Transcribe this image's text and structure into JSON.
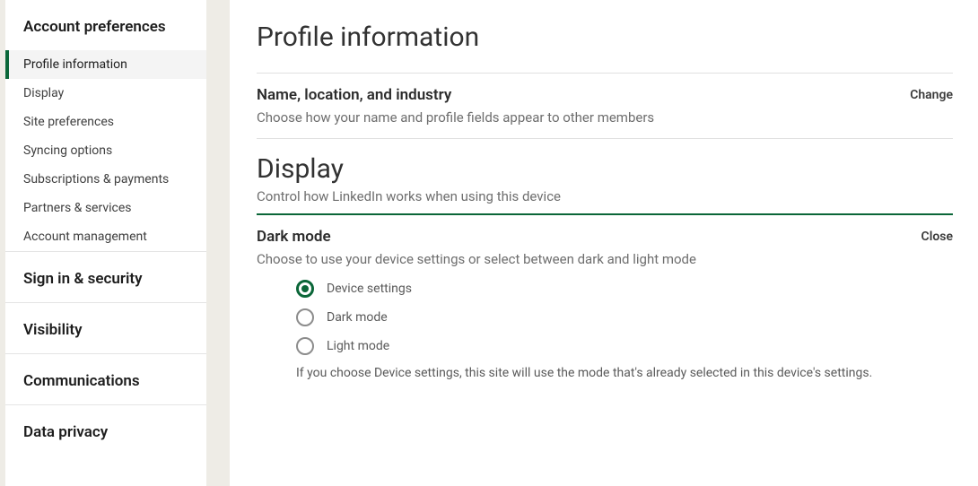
{
  "sidebar": {
    "groups": [
      {
        "header": "Account preferences",
        "items": [
          {
            "label": "Profile information",
            "active": true
          },
          {
            "label": "Display"
          },
          {
            "label": "Site preferences"
          },
          {
            "label": "Syncing options"
          },
          {
            "label": "Subscriptions & payments"
          },
          {
            "label": "Partners & services"
          },
          {
            "label": "Account management"
          }
        ]
      },
      {
        "header": "Sign in & security",
        "items": []
      },
      {
        "header": "Visibility",
        "items": []
      },
      {
        "header": "Communications",
        "items": []
      },
      {
        "header": "Data privacy",
        "items": []
      }
    ]
  },
  "main": {
    "profile_heading": "Profile information",
    "name_section": {
      "title": "Name, location, and industry",
      "desc": "Choose how your name and profile fields appear to other members",
      "action": "Change"
    },
    "display_heading": "Display",
    "display_sub": "Control how LinkedIn works when using this device",
    "dark_mode": {
      "title": "Dark mode",
      "desc": "Choose to use your device settings or select between dark and light mode",
      "action": "Close",
      "options": [
        {
          "label": "Device settings",
          "selected": true
        },
        {
          "label": "Dark mode",
          "selected": false
        },
        {
          "label": "Light mode",
          "selected": false
        }
      ],
      "hint": "If you choose Device settings, this site will use the mode that's already selected in this device's settings."
    }
  }
}
